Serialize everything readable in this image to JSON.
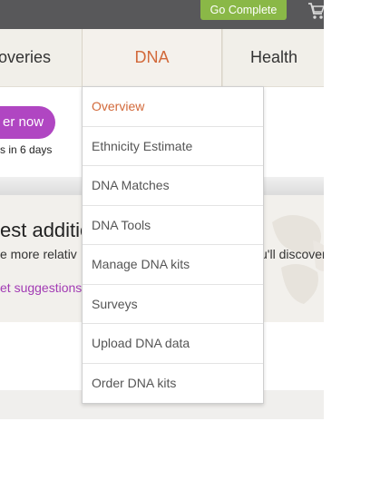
{
  "colors": {
    "accent_orange": "#d2693a",
    "purple": "#b046c2",
    "green": "#8ab847",
    "topbar": "#58585a"
  },
  "topbar": {
    "go_complete_label": "Go Complete",
    "cart_icon": "cart-icon"
  },
  "nav": {
    "items": [
      {
        "label": "overies"
      },
      {
        "label": "DNA"
      },
      {
        "label": "Health"
      }
    ]
  },
  "hero": {
    "order_label": "er now",
    "ships_text": "s in 6 days"
  },
  "panel": {
    "title": "est additio",
    "text_left": "e more relativ",
    "text_right": "u'll discover",
    "link": "et suggestions"
  },
  "dropdown": {
    "items": [
      {
        "label": "Overview"
      },
      {
        "label": "Ethnicity Estimate"
      },
      {
        "label": "DNA Matches"
      },
      {
        "label": "DNA Tools"
      },
      {
        "label": "Manage DNA kits"
      },
      {
        "label": "Surveys"
      },
      {
        "label": "Upload DNA data"
      },
      {
        "label": "Order DNA kits"
      }
    ]
  }
}
